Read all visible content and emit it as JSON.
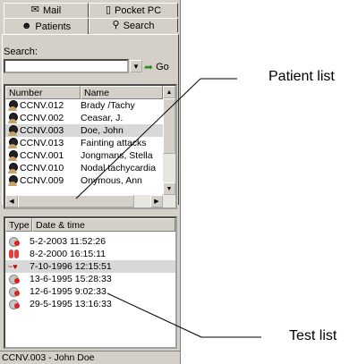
{
  "tabs": {
    "row1": [
      {
        "label": "Mail",
        "icon": "mail-icon"
      },
      {
        "label": "Pocket PC",
        "icon": "pocket-pc-icon"
      }
    ],
    "row2": [
      {
        "label": "Patients",
        "icon": "patients-icon",
        "active": true
      },
      {
        "label": "Search",
        "icon": "search-icon",
        "active": false
      }
    ]
  },
  "search": {
    "label": "Search:",
    "value": "",
    "go_label": "Go"
  },
  "patient_list": {
    "headers": [
      "Number",
      "Name"
    ],
    "rows": [
      {
        "number": "CCNV.012",
        "name": "Brady /Tachy",
        "selected": false
      },
      {
        "number": "CCNV.002",
        "name": "Ceasar, J.",
        "selected": false
      },
      {
        "number": "CCNV.003",
        "name": "Doe, John",
        "selected": true
      },
      {
        "number": "CCNV.013",
        "name": "Fainting attacks",
        "selected": false
      },
      {
        "number": "CCNV.001",
        "name": "Jongmans, Stella",
        "selected": false
      },
      {
        "number": "CCNV.010",
        "name": "Nodal tachycardia",
        "selected": false
      },
      {
        "number": "CCNV.009",
        "name": "Onymous, Ann",
        "selected": false
      }
    ]
  },
  "test_list": {
    "headers": [
      "Type",
      "Date & time"
    ],
    "rows": [
      {
        "type_icon": "holter-icon",
        "datetime": "5-2-2003 11:52:26",
        "selected": false
      },
      {
        "type_icon": "lung-icon",
        "datetime": "8-2-2000 16:15:11",
        "selected": false
      },
      {
        "type_icon": "ecg-icon",
        "datetime": "7-10-1996 12:15:51",
        "selected": true
      },
      {
        "type_icon": "holter-icon",
        "datetime": "13-6-1995 15:28:33",
        "selected": false
      },
      {
        "type_icon": "holter-icon",
        "datetime": "12-6-1995 9:02:33",
        "selected": false
      },
      {
        "type_icon": "holter-icon",
        "datetime": "29-5-1995 13:16:33",
        "selected": false
      }
    ]
  },
  "status_bar": {
    "text": "CCNV.003 - John Doe"
  },
  "annotations": {
    "patient_list": "Patient list",
    "test_list": "Test list"
  }
}
